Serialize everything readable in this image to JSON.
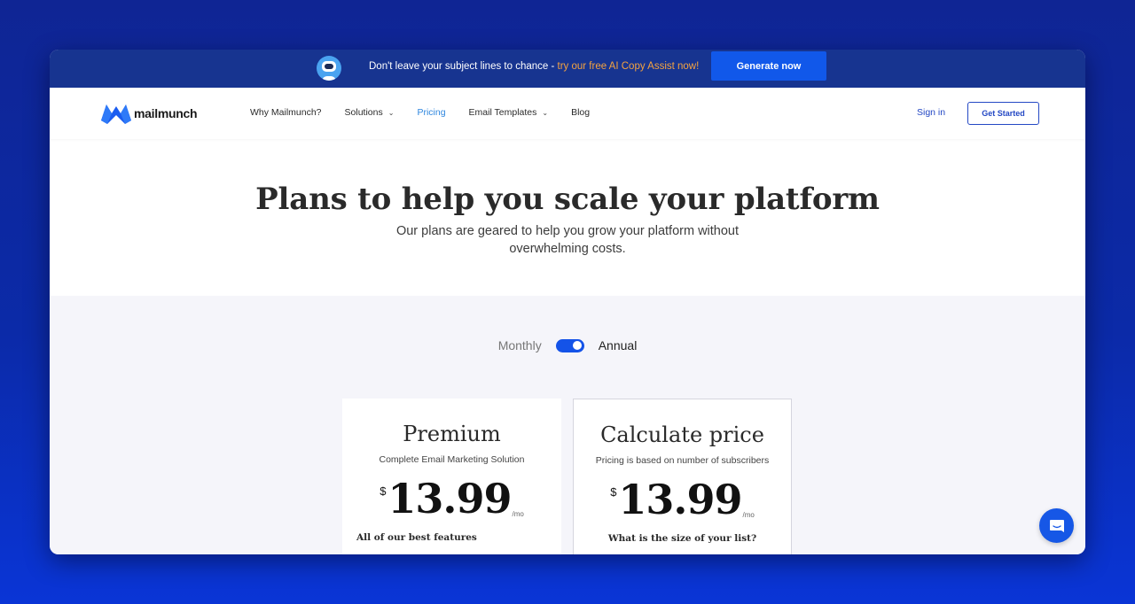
{
  "promo": {
    "message": "Don't leave your subject lines to chance - ",
    "highlight": "try our free AI Copy Assist now!",
    "button_label": "Generate now",
    "icon": "robot-avatar-icon"
  },
  "nav": {
    "brand": "mailmunch",
    "items": [
      {
        "label": "Why Mailmunch?",
        "dropdown": false,
        "active": false
      },
      {
        "label": "Solutions",
        "dropdown": true,
        "active": false
      },
      {
        "label": "Pricing",
        "dropdown": false,
        "active": true
      },
      {
        "label": "Email Templates",
        "dropdown": true,
        "active": false
      },
      {
        "label": "Blog",
        "dropdown": false,
        "active": false
      }
    ],
    "sign_in": "Sign in",
    "get_started": "Get Started"
  },
  "hero": {
    "title": "Plans to help you scale your platform",
    "subtitle": "Our plans are geared to help you grow your platform without overwhelming costs."
  },
  "billing_toggle": {
    "left_label": "Monthly",
    "right_label": "Annual",
    "selected": "Annual"
  },
  "plans": [
    {
      "title": "Premium",
      "subtitle": "Complete Email Marketing Solution",
      "currency": "$",
      "price": "13.99",
      "period": "/mo",
      "footer": "All of our best features"
    },
    {
      "title": "Calculate price",
      "subtitle": "Pricing is based on number of subscribers",
      "currency": "$",
      "price": "13.99",
      "period": "/mo",
      "footer": "What is the size of your list?"
    }
  ],
  "colors": {
    "accent": "#1158ea",
    "promo_bg": "#173490",
    "highlight": "#f4a340",
    "nav_active": "#2e86de",
    "link": "#2448c4"
  }
}
